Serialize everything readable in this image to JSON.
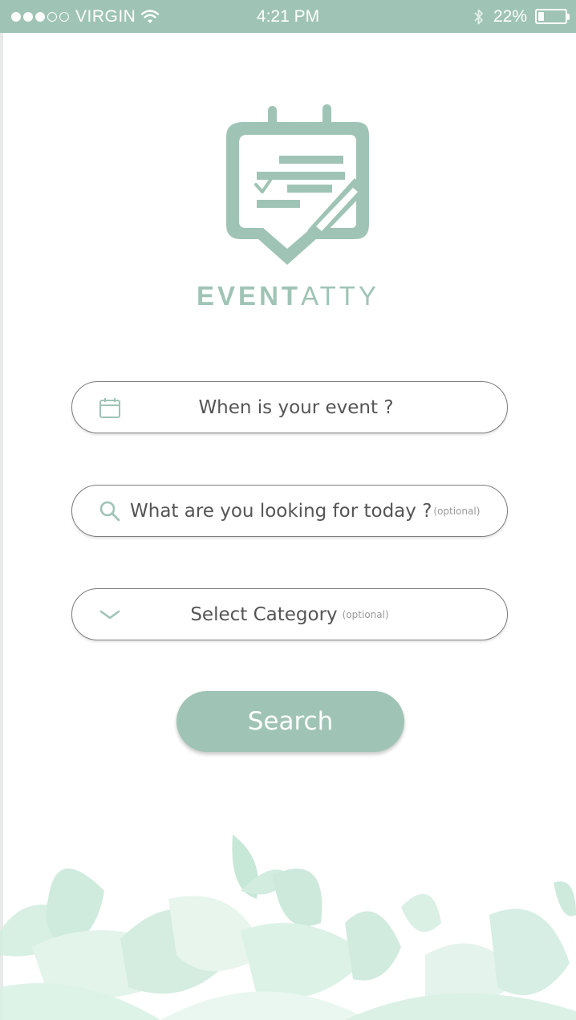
{
  "status_bar": {
    "carrier": "VIRGIN",
    "time": "4:21 PM",
    "battery_percent": "22%",
    "battery_level": 0.22,
    "signal_bars_filled": 3,
    "signal_bars_total": 5
  },
  "brand": {
    "name_bold": "EVENT",
    "name_light": "ATTY",
    "color": "#9fc4b6"
  },
  "form": {
    "date_label": "When is your event ?",
    "search_label": "What are you looking for today ?",
    "search_optional": "(optional)",
    "category_label": "Select Category",
    "category_optional": "(optional)"
  },
  "search_button": {
    "label": "Search"
  },
  "icons": {
    "date": "calendar-icon",
    "search": "search-icon",
    "category": "chevron-down-icon"
  },
  "colors": {
    "accent": "#9fc4b6",
    "pill_border": "#7d7d7d",
    "text": "#555555",
    "leaf_light": "#d7efe3",
    "leaf_mid": "#c2e6d4"
  }
}
